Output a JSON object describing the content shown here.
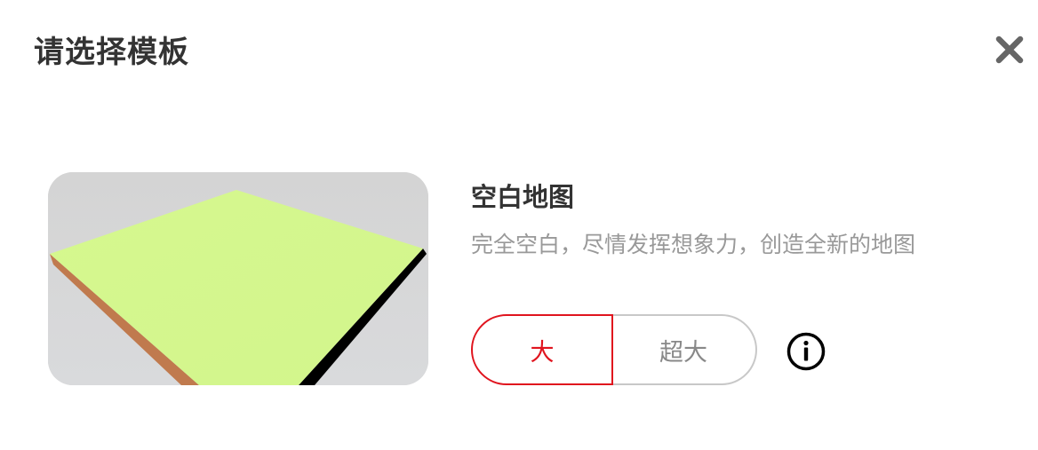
{
  "dialog": {
    "title": "请选择模板",
    "close_icon": "close-icon"
  },
  "template": {
    "name": "空白地图",
    "description": "完全空白，尽情发挥想象力，创造全新的地图",
    "thumbnail_icon": "blank-map-terrain",
    "sizes": [
      {
        "label": "大",
        "selected": true
      },
      {
        "label": "超大",
        "selected": false
      }
    ],
    "info_icon": "info-icon"
  },
  "colors": {
    "accent": "#e0141e",
    "title_text": "#333333",
    "muted_text": "#999999",
    "terrain_top": "#d4f78f",
    "terrain_side": "#c07a4e",
    "thumbnail_bg": "#d3d3d3"
  }
}
